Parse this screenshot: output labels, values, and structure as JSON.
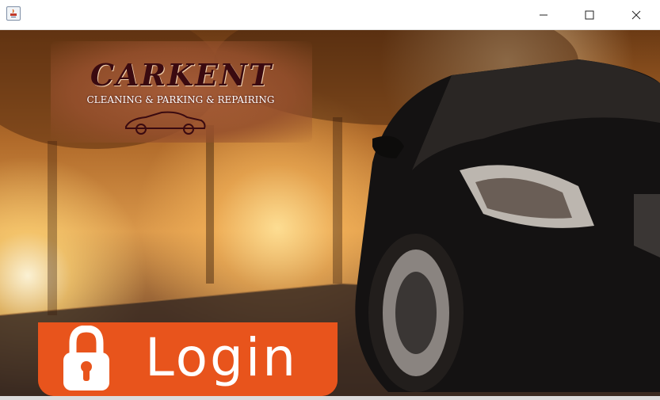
{
  "window": {
    "icons": {
      "app": "java-app-icon",
      "minimize": "minimize-icon",
      "maximize": "maximize-icon",
      "close": "close-icon"
    }
  },
  "logo": {
    "title": "CARKENT",
    "subtitle": "CLEANING & PARKING & REPAIRING"
  },
  "login": {
    "label": "Login",
    "icon": "lock-icon",
    "color": "#e8541c"
  }
}
